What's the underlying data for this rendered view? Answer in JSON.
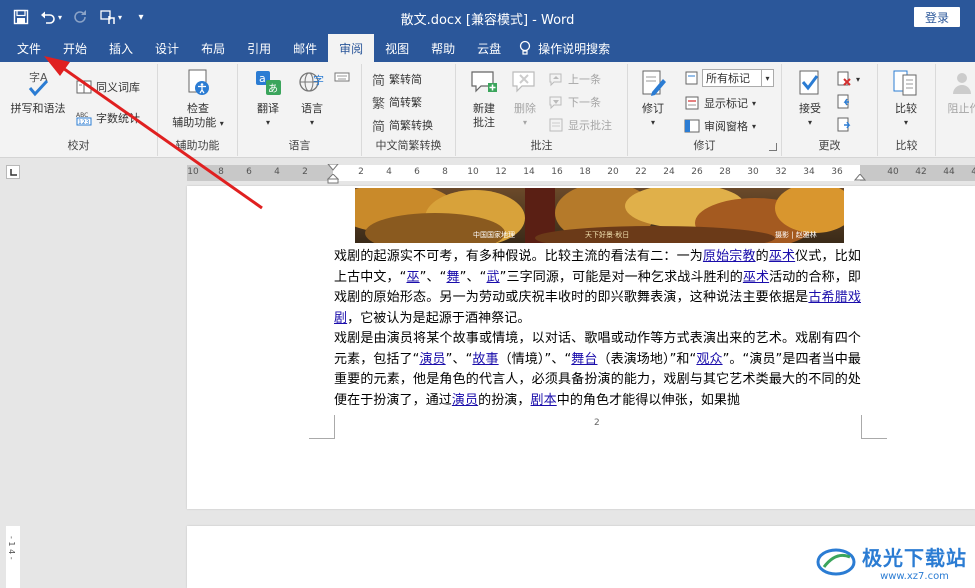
{
  "titlebar": {
    "document_title": "散文.docx [兼容模式]  -  Word",
    "login_label": "登录",
    "qat_more": "▾"
  },
  "tabs": [
    {
      "label": "文件"
    },
    {
      "label": "开始"
    },
    {
      "label": "插入"
    },
    {
      "label": "设计"
    },
    {
      "label": "布局"
    },
    {
      "label": "引用"
    },
    {
      "label": "邮件"
    },
    {
      "label": "审阅"
    },
    {
      "label": "视图"
    },
    {
      "label": "帮助"
    },
    {
      "label": "云盘"
    }
  ],
  "active_tab": "审阅",
  "tell_me": "操作说明搜索",
  "ribbon": {
    "proofing": {
      "label": "校对",
      "spell_grammar": "拼写和语法",
      "thesaurus": "同义词库",
      "word_count": "字数统计"
    },
    "accessibility": {
      "label": "辅助功能",
      "check_line1": "检查",
      "check_line2": "辅助功能"
    },
    "language": {
      "label": "语言",
      "translate": "翻译",
      "language": "语言"
    },
    "chinese_conversion": {
      "label": "中文简繁转换",
      "to_traditional": "繁转简",
      "to_simplified": "简转繁",
      "convert": "简繁转换"
    },
    "comments": {
      "label": "批注",
      "new_line1": "新建",
      "new_line2": "批注",
      "delete": "删除",
      "previous": "上一条",
      "next": "下一条",
      "show": "显示批注"
    },
    "tracking": {
      "label": "修订",
      "track_changes": "修订",
      "markup_select": "所有标记",
      "show_markup": "显示标记",
      "reviewing_pane": "审阅窗格"
    },
    "changes": {
      "label": "更改",
      "accept": "接受"
    },
    "compare": {
      "label": "比较",
      "compare": "比较"
    },
    "protect": {
      "block": "阻止作"
    }
  },
  "ruler": {
    "left_numbers": [
      "10",
      "8",
      "6",
      "4",
      "2"
    ],
    "right_numbers": [
      "2",
      "4",
      "6",
      "8",
      "10",
      "12",
      "14",
      "16",
      "18",
      "20",
      "22",
      "24",
      "26",
      "28",
      "30",
      "32",
      "34",
      "36"
    ],
    "far_numbers": [
      "40",
      "42",
      "44",
      "46"
    ]
  },
  "vruler_label": "- 1 4 -",
  "document": {
    "image_caption_left": "中国国家地理",
    "image_caption_mid": "天下好景·秋日",
    "image_caption_right": "摄影 | 赵雅林",
    "p1": [
      {
        "t": "戏剧的起源实不可考，有多种假说。比较主流的看法有二：一为"
      },
      {
        "t": "原始宗教",
        "link": true
      },
      {
        "t": "的"
      },
      {
        "t": "巫术",
        "link": true
      },
      {
        "t": "仪式，比如上古中文，“"
      },
      {
        "t": "巫",
        "link": true
      },
      {
        "t": "”、“"
      },
      {
        "t": "舞",
        "link": true
      },
      {
        "t": "”、“"
      },
      {
        "t": "武",
        "link": true
      },
      {
        "t": "”三字同源，可能是对一种乞求战斗胜利的"
      },
      {
        "t": "巫术",
        "link": true
      },
      {
        "t": "活动的合称，即戏剧的原始形态。另一为劳动或庆祝丰收时的即兴歌舞表演，这种说法主要依据是"
      },
      {
        "t": "古希腊戏剧",
        "link": true
      },
      {
        "t": "，它被认为是起源于酒神祭记。"
      }
    ],
    "p2": [
      {
        "t": "戏剧是由演员将某个故事或情境，以对话、歌唱或动作等方式表演出来的艺术。戏剧有四个元素，包括了“"
      },
      {
        "t": "演员",
        "link": true
      },
      {
        "t": "”、“"
      },
      {
        "t": "故事",
        "link": true
      },
      {
        "t": "（情境）”、“"
      },
      {
        "t": "舞台",
        "link": true
      },
      {
        "t": "（表演场地）”和“"
      },
      {
        "t": "观众",
        "link": true
      },
      {
        "t": "”。“演员”是四者当中最重要的元素，他是角色的代言人，必须具备扮演的能力，戏剧与其它艺术类最大的不同的处便在于扮演了，通过"
      },
      {
        "t": "演员",
        "link": true
      },
      {
        "t": "的扮演，"
      },
      {
        "t": "剧本",
        "link": true
      },
      {
        "t": "中的角色才能得以伸张，如果抛"
      }
    ],
    "page_number": "2"
  },
  "watermark": {
    "brand": "极光下载站",
    "url": "www.xz7.com"
  },
  "colors": {
    "word_blue": "#2b579a",
    "arrow_red": "#e02020",
    "link_blue": "#1a0dab"
  }
}
